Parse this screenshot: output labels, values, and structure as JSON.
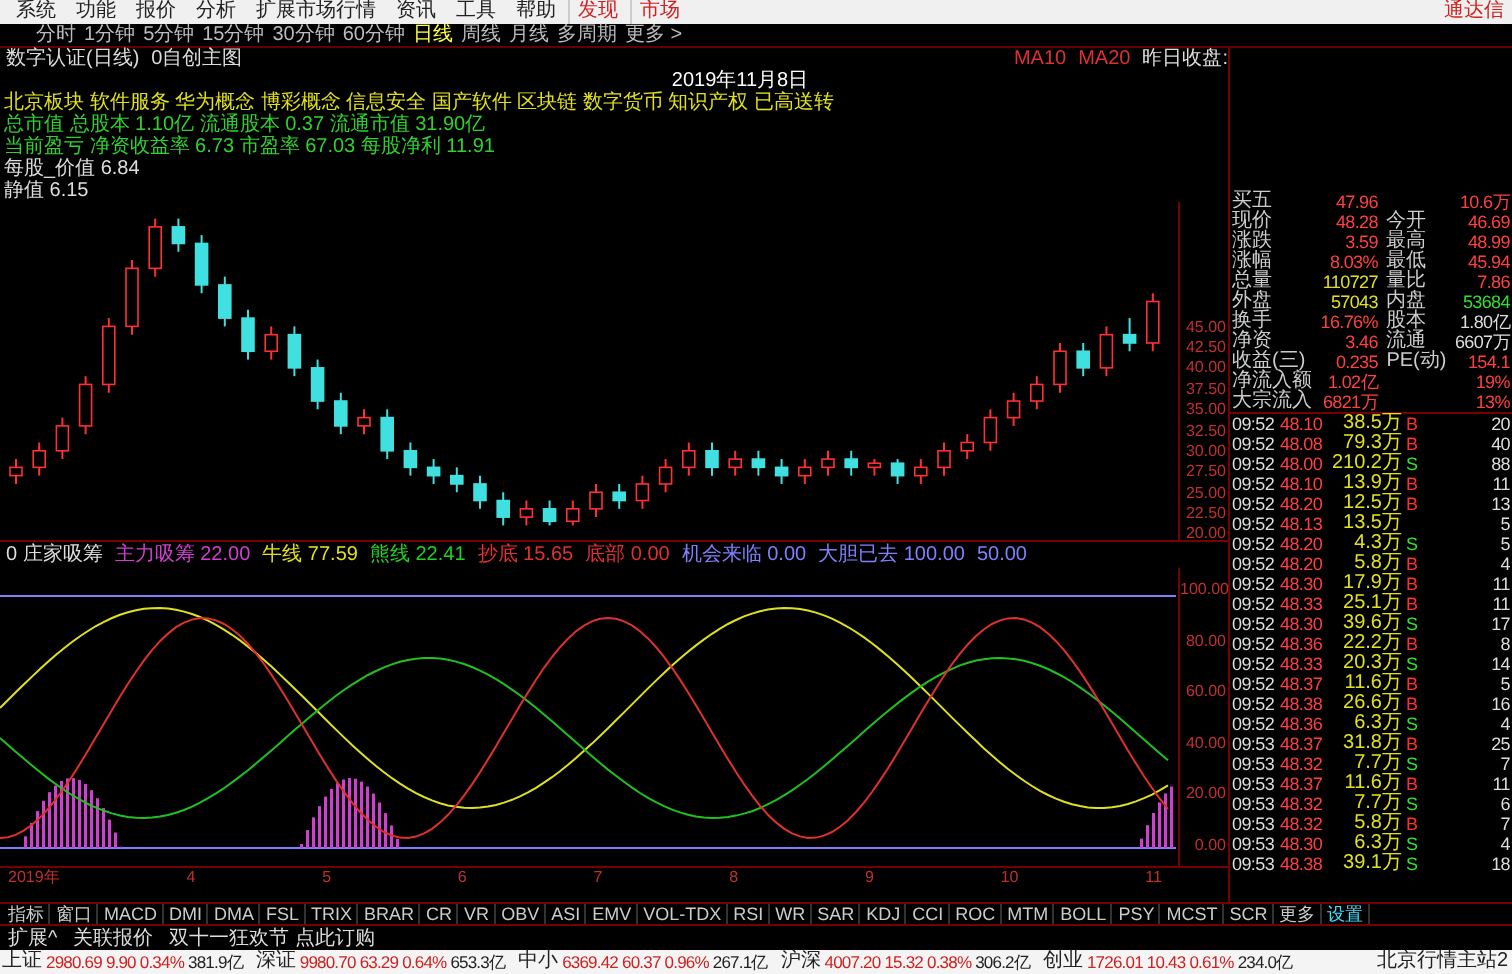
{
  "menu": {
    "items": [
      "系统",
      "功能",
      "报价",
      "分析",
      "扩展市场行情",
      "资讯",
      "工具",
      "帮助"
    ],
    "highlights": [
      "发现",
      "市场"
    ],
    "brand": "通达信"
  },
  "periods": [
    {
      "label": "分时",
      "selected": false
    },
    {
      "label": "1分钟",
      "selected": false
    },
    {
      "label": "5分钟",
      "selected": false
    },
    {
      "label": "15分钟",
      "selected": false
    },
    {
      "label": "30分钟",
      "selected": false
    },
    {
      "label": "60分钟",
      "selected": false
    },
    {
      "label": "日线",
      "selected": true
    },
    {
      "label": "周线",
      "selected": false
    },
    {
      "label": "月线",
      "selected": false
    },
    {
      "label": "多周期",
      "selected": false
    },
    {
      "label": "更多 >",
      "selected": false
    }
  ],
  "chart_title": {
    "stock": "数字认证(日线)",
    "template": "0自创主图",
    "ma": [
      "MA10",
      "MA20"
    ],
    "prev_close": "昨日收盘:"
  },
  "main_chart": {
    "chart_data": {
      "type": "candlestick",
      "ylim": [
        19,
        60
      ],
      "yticks": [
        {
          "value": 45,
          "label": "45.00"
        },
        {
          "value": 42.5,
          "label": "42.50"
        },
        {
          "value": 40,
          "label": "40.00"
        },
        {
          "value": 37.5,
          "label": "37.50"
        },
        {
          "value": 35,
          "label": "35.00"
        },
        {
          "value": 32.5,
          "label": "32.50"
        },
        {
          "value": 30,
          "label": "30.00"
        },
        {
          "value": 27.5,
          "label": "27.50"
        },
        {
          "value": 25,
          "label": "25.00"
        },
        {
          "value": 22.5,
          "label": "22.50"
        },
        {
          "value": 20,
          "label": "20.00"
        }
      ],
      "ohlc": [
        [
          27,
          29,
          26,
          28
        ],
        [
          28,
          31,
          27,
          30
        ],
        [
          30,
          34,
          29,
          33
        ],
        [
          33,
          39,
          32,
          38
        ],
        [
          38,
          46,
          37,
          45
        ],
        [
          45,
          53,
          44,
          52
        ],
        [
          52,
          58,
          51,
          57
        ],
        [
          57,
          58,
          54,
          55
        ],
        [
          55,
          56,
          49,
          50
        ],
        [
          50,
          51,
          45,
          46
        ],
        [
          46,
          47,
          41,
          42
        ],
        [
          42,
          45,
          41,
          44
        ],
        [
          44,
          45,
          39,
          40
        ],
        [
          40,
          41,
          35,
          36
        ],
        [
          36,
          37,
          32,
          33
        ],
        [
          33,
          35,
          32,
          34
        ],
        [
          34,
          35,
          29,
          30
        ],
        [
          30,
          31,
          27,
          28
        ],
        [
          28,
          29,
          26,
          27
        ],
        [
          27,
          28,
          25,
          26
        ],
        [
          26,
          27,
          23,
          24
        ],
        [
          24,
          25,
          21,
          22
        ],
        [
          22,
          24,
          21,
          23
        ],
        [
          23,
          24,
          21,
          21.5
        ],
        [
          21.5,
          24,
          21,
          23
        ],
        [
          23,
          26,
          22,
          25
        ],
        [
          25,
          26,
          23,
          24
        ],
        [
          24,
          27,
          23,
          26
        ],
        [
          26,
          29,
          25,
          28
        ],
        [
          28,
          31,
          27,
          30
        ],
        [
          30,
          31,
          27,
          28
        ],
        [
          28,
          30,
          27,
          29
        ],
        [
          29,
          30,
          27,
          28
        ],
        [
          28,
          29,
          26,
          27
        ],
        [
          27,
          29,
          26,
          28
        ],
        [
          28,
          30,
          27,
          29
        ],
        [
          29,
          30,
          27,
          28
        ],
        [
          28,
          29,
          27,
          28.5
        ],
        [
          28.5,
          29,
          26,
          27
        ],
        [
          27,
          29,
          26,
          28
        ],
        [
          28,
          31,
          27,
          30
        ],
        [
          30,
          32,
          29,
          31
        ],
        [
          31,
          35,
          30,
          34
        ],
        [
          34,
          37,
          33,
          36
        ],
        [
          36,
          39,
          35,
          38
        ],
        [
          38,
          43,
          37,
          42
        ],
        [
          42,
          43,
          39,
          40
        ],
        [
          40,
          45,
          39,
          44
        ],
        [
          44,
          46,
          42,
          43
        ],
        [
          43,
          49,
          42,
          48
        ]
      ]
    },
    "date": "2019年11月8日",
    "concepts": "北京板块 软件服务 华为概念 博彩概念 信息安全 国产软件 区块链 数字货币 知识产权 已高送转",
    "cap_lines": [
      "总市值 总股本 1.10亿 流通股本 0.37 流通市值 31.90亿",
      "当前盈亏 净资收益率 6.73 市盈率 67.03 每股净利 11.91"
    ],
    "side_labels": [
      "每股_价值 6.84",
      "静值 6.15"
    ]
  },
  "indicator": {
    "name": "0 庄家吸筹",
    "values": [
      {
        "text": "主力吸筹 22.00",
        "color": "#d040d0"
      },
      {
        "text": "牛线 77.59",
        "color": "#e0e020"
      },
      {
        "text": "熊线 22.41",
        "color": "#20d020"
      },
      {
        "text": "抄底 15.65",
        "color": "#e03030"
      },
      {
        "text": "底部 0.00",
        "color": "#e03030"
      },
      {
        "text": "机会来临 0.00",
        "color": "#8080ff"
      },
      {
        "text": "大胆已去 100.00",
        "color": "#8080ff"
      },
      {
        "text": "50.00",
        "color": "#8080ff"
      }
    ],
    "axis": [
      "100.00",
      "80.00",
      "60.00",
      "40.00",
      "20.00",
      "0.00"
    ]
  },
  "time_axis": [
    "2019年",
    "4",
    "5",
    "6",
    "7",
    "8",
    "9",
    "10",
    "11"
  ],
  "indicator_tabs": [
    {
      "label": "指标",
      "selected": false
    },
    {
      "label": "窗口",
      "selected": false
    },
    {
      "label": "MACD",
      "selected": false
    },
    {
      "label": "DMI",
      "selected": false
    },
    {
      "label": "DMA",
      "selected": false
    },
    {
      "label": "FSL",
      "selected": false
    },
    {
      "label": "TRIX",
      "selected": false
    },
    {
      "label": "BRAR",
      "selected": false
    },
    {
      "label": "CR",
      "selected": false
    },
    {
      "label": "VR",
      "selected": false
    },
    {
      "label": "OBV",
      "selected": false
    },
    {
      "label": "ASI",
      "selected": false
    },
    {
      "label": "EMV",
      "selected": false
    },
    {
      "label": "VOL-TDX",
      "selected": false
    },
    {
      "label": "RSI",
      "selected": false
    },
    {
      "label": "WR",
      "selected": false
    },
    {
      "label": "SAR",
      "selected": false
    },
    {
      "label": "KDJ",
      "selected": false
    },
    {
      "label": "CCI",
      "selected": false
    },
    {
      "label": "ROC",
      "selected": false
    },
    {
      "label": "MTM",
      "selected": false
    },
    {
      "label": "BOLL",
      "selected": false
    },
    {
      "label": "PSY",
      "selected": false
    },
    {
      "label": "MCST",
      "selected": false
    },
    {
      "label": "SCR",
      "selected": false
    },
    {
      "label": "更多",
      "selected": false
    },
    {
      "label": "设置",
      "selected": true
    }
  ],
  "sub_bar": [
    "扩展^",
    "关联报价",
    "双十一狂欢节 点此订购"
  ],
  "indices": [
    {
      "name": "上证",
      "value": "2980.69",
      "change": "9.90",
      "pct": "0.34%",
      "amount": "381.9亿"
    },
    {
      "name": "深证",
      "value": "9980.70",
      "change": "63.29",
      "pct": "0.64%",
      "amount": "653.3亿"
    },
    {
      "name": "中小",
      "value": "6369.42",
      "change": "60.37",
      "pct": "0.96%",
      "amount": "267.1亿"
    },
    {
      "name": "沪深",
      "value": "4007.20",
      "change": "15.32",
      "pct": "0.38%",
      "amount": "306.2亿"
    },
    {
      "name": "创业",
      "value": "1726.01",
      "change": "10.43",
      "pct": "0.61%",
      "amount": "234.0亿"
    }
  ],
  "server": "北京行情主站2",
  "quote": [
    {
      "l1": "买五",
      "v1": "47.96",
      "v2": "10.6万"
    },
    {
      "l1": "现价",
      "v1": "48.28",
      "l2": "今开",
      "v2": "46.69"
    },
    {
      "l1": "涨跌",
      "v1": "3.59",
      "l2": "最高",
      "v2": "48.99"
    },
    {
      "l1": "涨幅",
      "v1": "8.03%",
      "l2": "最低",
      "v2": "45.94"
    },
    {
      "l1": "总量",
      "v1": "110727",
      "l2": "量比",
      "v2": "7.86"
    },
    {
      "l1": "外盘",
      "v1": "57043",
      "l2": "内盘",
      "v2": "53684"
    },
    {
      "l1": "换手",
      "v1": "16.76%",
      "l2": "股本",
      "v2": "1.80亿"
    },
    {
      "l1": "净资",
      "v1": "3.46",
      "l2": "流通",
      "v2": "6607万"
    },
    {
      "l1": "收益(三)",
      "v1": "0.235",
      "l2": "PE(动)",
      "v2": "154.1"
    },
    {
      "l1": "净流入额",
      "v1": "1.02亿",
      "v2": "19%"
    },
    {
      "l1": "大宗流入",
      "v1": "6821万",
      "v2": "13%"
    }
  ],
  "ticks": [
    {
      "time": "09:52",
      "price": "48.10",
      "vol": "38.5万",
      "side": "B",
      "kind": "buy",
      "count": "20"
    },
    {
      "time": "09:52",
      "price": "48.08",
      "vol": "79.3万",
      "side": "B",
      "kind": "buy",
      "count": "40"
    },
    {
      "time": "09:52",
      "price": "48.00",
      "vol": "210.2万",
      "side": "S",
      "kind": "sell",
      "count": "88"
    },
    {
      "time": "09:52",
      "price": "48.10",
      "vol": "13.9万",
      "side": "B",
      "kind": "buy",
      "count": "11"
    },
    {
      "time": "09:52",
      "price": "48.20",
      "vol": "12.5万",
      "side": "B",
      "kind": "buy",
      "count": "13"
    },
    {
      "time": "09:52",
      "price": "48.13",
      "vol": "13.5万",
      "kind": "none",
      "count": "5"
    },
    {
      "time": "09:52",
      "price": "48.20",
      "vol": "4.3万",
      "side": "S",
      "kind": "sell",
      "count": "5"
    },
    {
      "time": "09:52",
      "price": "48.20",
      "vol": "5.8万",
      "side": "B",
      "kind": "buy",
      "count": "4"
    },
    {
      "time": "09:52",
      "price": "48.30",
      "vol": "17.9万",
      "side": "B",
      "kind": "buy",
      "count": "11"
    },
    {
      "time": "09:52",
      "price": "48.33",
      "vol": "25.1万",
      "side": "B",
      "kind": "buy",
      "count": "11"
    },
    {
      "time": "09:52",
      "price": "48.30",
      "vol": "39.6万",
      "side": "S",
      "kind": "sell",
      "count": "17"
    },
    {
      "time": "09:52",
      "price": "48.36",
      "vol": "22.2万",
      "side": "B",
      "kind": "buy",
      "count": "8"
    },
    {
      "time": "09:52",
      "price": "48.33",
      "vol": "20.3万",
      "side": "S",
      "kind": "sell",
      "count": "14"
    },
    {
      "time": "09:52",
      "price": "48.37",
      "vol": "11.6万",
      "side": "B",
      "kind": "buy",
      "count": "5"
    },
    {
      "time": "09:52",
      "price": "48.38",
      "vol": "26.6万",
      "side": "B",
      "kind": "buy",
      "count": "16"
    },
    {
      "time": "09:52",
      "price": "48.36",
      "vol": "6.3万",
      "side": "S",
      "kind": "sell",
      "count": "4"
    },
    {
      "time": "09:53",
      "price": "48.37",
      "vol": "31.8万",
      "side": "B",
      "kind": "buy",
      "count": "25"
    },
    {
      "time": "09:53",
      "price": "48.32",
      "vol": "7.7万",
      "side": "S",
      "kind": "sell",
      "count": "7"
    },
    {
      "time": "09:53",
      "price": "48.37",
      "vol": "11.6万",
      "side": "B",
      "kind": "buy",
      "count": "11"
    },
    {
      "time": "09:53",
      "price": "48.32",
      "vol": "7.7万",
      "side": "S",
      "kind": "sell",
      "count": "6"
    },
    {
      "time": "09:53",
      "price": "48.32",
      "vol": "5.8万",
      "side": "B",
      "kind": "buy",
      "count": "7"
    },
    {
      "time": "09:53",
      "price": "48.30",
      "vol": "6.3万",
      "side": "S",
      "kind": "sell",
      "count": "4"
    },
    {
      "time": "09:53",
      "price": "48.38",
      "vol": "39.1万",
      "side": "S",
      "kind": "sell",
      "count": "18"
    }
  ]
}
